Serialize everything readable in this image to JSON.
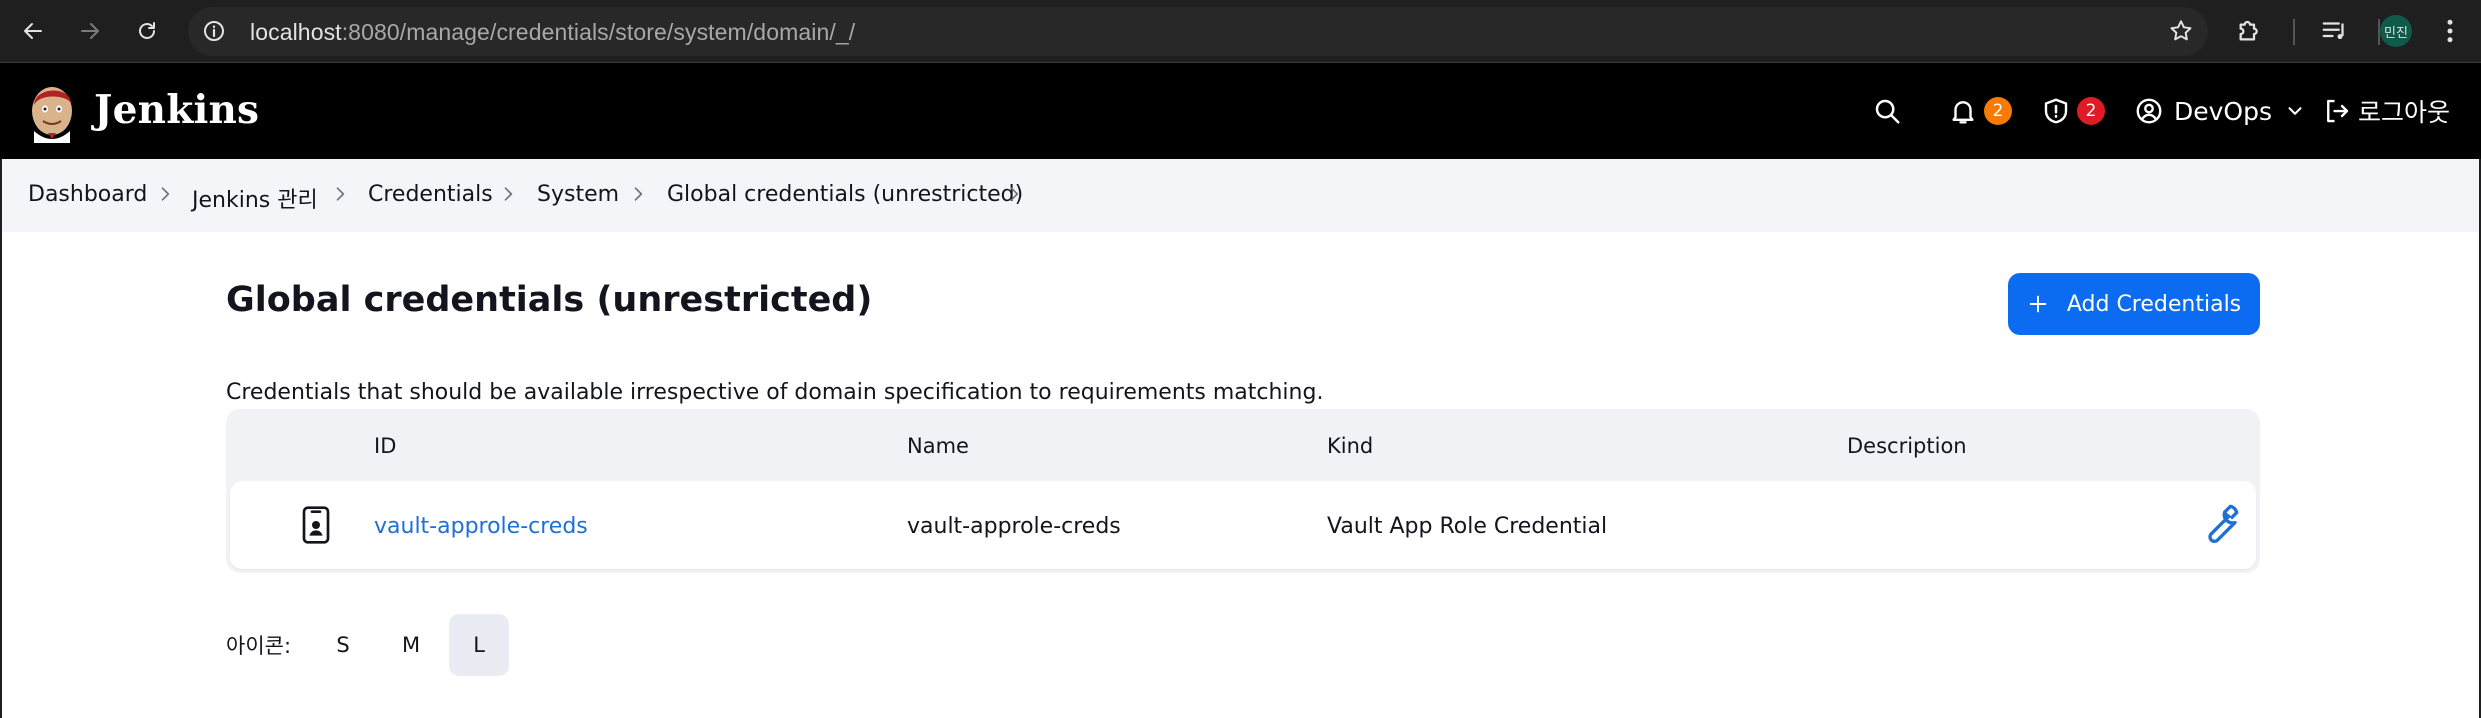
{
  "browser": {
    "url_host": "localhost",
    "url_path": ":8080/manage/credentials/store/system/domain/_/",
    "profile_initials": "민진"
  },
  "header": {
    "brand": "Jenkins",
    "notifications_count": "2",
    "security_count": "2",
    "user_name": "DevOps",
    "logout_label": "로그아웃"
  },
  "breadcrumb": [
    "Dashboard",
    "Jenkins 관리",
    "Credentials",
    "System",
    "Global credentials (unrestricted)"
  ],
  "main": {
    "title": "Global credentials (unrestricted)",
    "add_button_label": "Add Credentials",
    "description": "Credentials that should be available irrespective of domain specification to requirements matching."
  },
  "table": {
    "columns": [
      "ID",
      "Name",
      "Kind",
      "Description"
    ],
    "rows": [
      {
        "id": "vault-approle-creds",
        "name": "vault-approle-creds",
        "kind": "Vault App Role Credential",
        "description": ""
      }
    ]
  },
  "icon_size": {
    "label": "아이콘:",
    "options": [
      "S",
      "M",
      "L"
    ],
    "selected": "L"
  },
  "colors": {
    "accent": "#0b6cf2",
    "link": "#1f6fd8",
    "header_bg": "#000000",
    "breadcrumb_bg": "#f3f5f8",
    "badge_orange": "#f57c00",
    "badge_red": "#e01b24"
  }
}
